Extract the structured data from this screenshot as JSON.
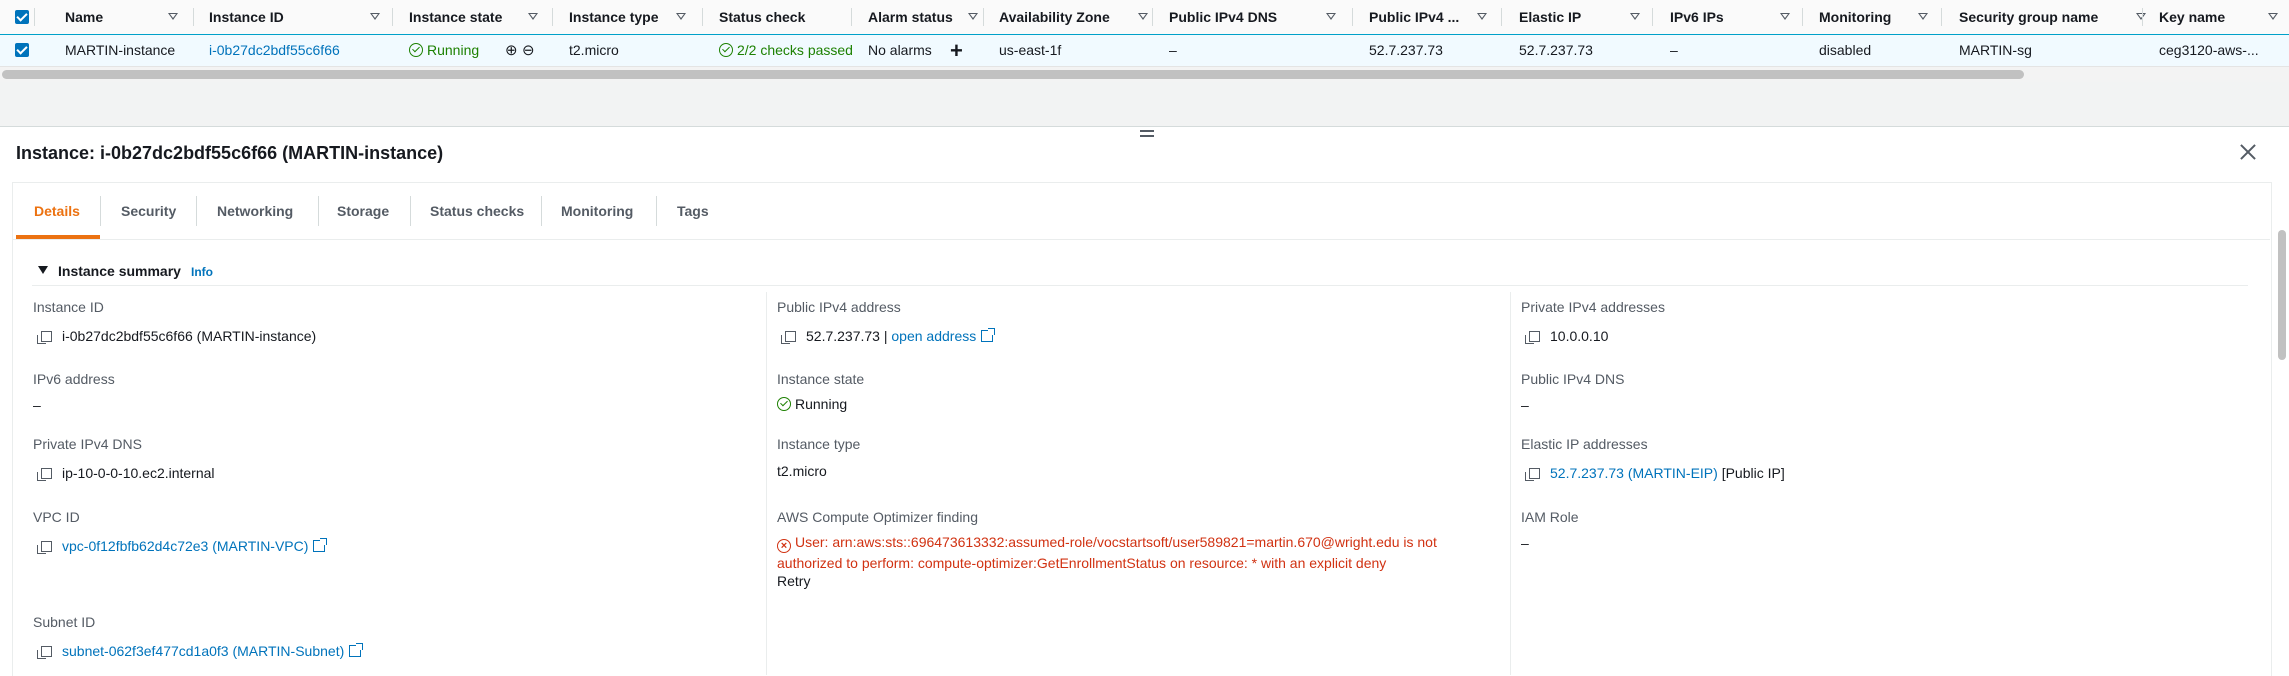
{
  "table": {
    "columns": [
      {
        "key": "name",
        "label": "Name"
      },
      {
        "key": "instance_id",
        "label": "Instance ID"
      },
      {
        "key": "instance_state",
        "label": "Instance state"
      },
      {
        "key": "instance_type",
        "label": "Instance type"
      },
      {
        "key": "status_check",
        "label": "Status check"
      },
      {
        "key": "alarm_status",
        "label": "Alarm status"
      },
      {
        "key": "availability_zone",
        "label": "Availability Zone"
      },
      {
        "key": "public_dns",
        "label": "Public IPv4 DNS"
      },
      {
        "key": "public_ip",
        "label": "Public IPv4 ..."
      },
      {
        "key": "elastic_ip",
        "label": "Elastic IP"
      },
      {
        "key": "ipv6",
        "label": "IPv6 IPs"
      },
      {
        "key": "monitoring",
        "label": "Monitoring"
      },
      {
        "key": "sg_name",
        "label": "Security group name"
      },
      {
        "key": "key_name",
        "label": "Key name"
      }
    ],
    "row": {
      "selected": true,
      "name": "MARTIN-instance",
      "instance_id": "i-0b27dc2bdf55c6f66",
      "instance_state": "Running",
      "instance_type": "t2.micro",
      "status_check": "2/2 checks passed",
      "alarm_status": "No alarms",
      "availability_zone": "us-east-1f",
      "public_dns": "–",
      "public_ip": "52.7.237.73",
      "elastic_ip": "52.7.237.73",
      "ipv6": "–",
      "monitoring": "disabled",
      "sg_name": "MARTIN-sg",
      "key_name": "ceg3120-aws-..."
    }
  },
  "panel": {
    "title": "Instance: i-0b27dc2bdf55c6f66 (MARTIN-instance)",
    "tabs": [
      "Details",
      "Security",
      "Networking",
      "Storage",
      "Status checks",
      "Monitoring",
      "Tags"
    ],
    "active_tab": "Details",
    "section_title": "Instance summary",
    "info_label": "Info",
    "fields": {
      "instance_id": {
        "label": "Instance ID",
        "value": "i-0b27dc2bdf55c6f66 (MARTIN-instance)"
      },
      "ipv6_address": {
        "label": "IPv6 address",
        "value": "–"
      },
      "private_dns": {
        "label": "Private IPv4 DNS",
        "value": "ip-10-0-0-10.ec2.internal"
      },
      "vpc_id": {
        "label": "VPC ID",
        "value": "vpc-0f12fbfb62d4c72e3 (MARTIN-VPC)"
      },
      "subnet_id": {
        "label": "Subnet ID",
        "value": "subnet-062f3ef477cd1a0f3 (MARTIN-Subnet)"
      },
      "public_ipv4": {
        "label": "Public IPv4 address",
        "value": "52.7.237.73",
        "sep": " | ",
        "link": "open address"
      },
      "instance_state": {
        "label": "Instance state",
        "value": "Running"
      },
      "instance_type": {
        "label": "Instance type",
        "value": "t2.micro"
      },
      "optimizer": {
        "label": "AWS Compute Optimizer finding",
        "error_line1": "User: arn:aws:sts::696473613332:assumed-role/vocstartsoft/user589821=martin.670@wright.edu is not",
        "error_line2": "authorized to perform: compute-optimizer:GetEnrollmentStatus on resource: * with an explicit deny",
        "retry": "Retry"
      },
      "private_ipv4": {
        "label": "Private IPv4 addresses",
        "value": "10.0.0.10"
      },
      "public_dns": {
        "label": "Public IPv4 DNS",
        "value": "–"
      },
      "elastic_ips": {
        "label": "Elastic IP addresses",
        "value": "52.7.237.73 (MARTIN-EIP)",
        "suffix": " [Public IP]"
      },
      "iam_role": {
        "label": "IAM Role",
        "value": "–"
      }
    }
  },
  "colors": {
    "accent": "#ec7211",
    "link": "#0073bb",
    "success": "#1d8102",
    "error": "#d13212"
  }
}
